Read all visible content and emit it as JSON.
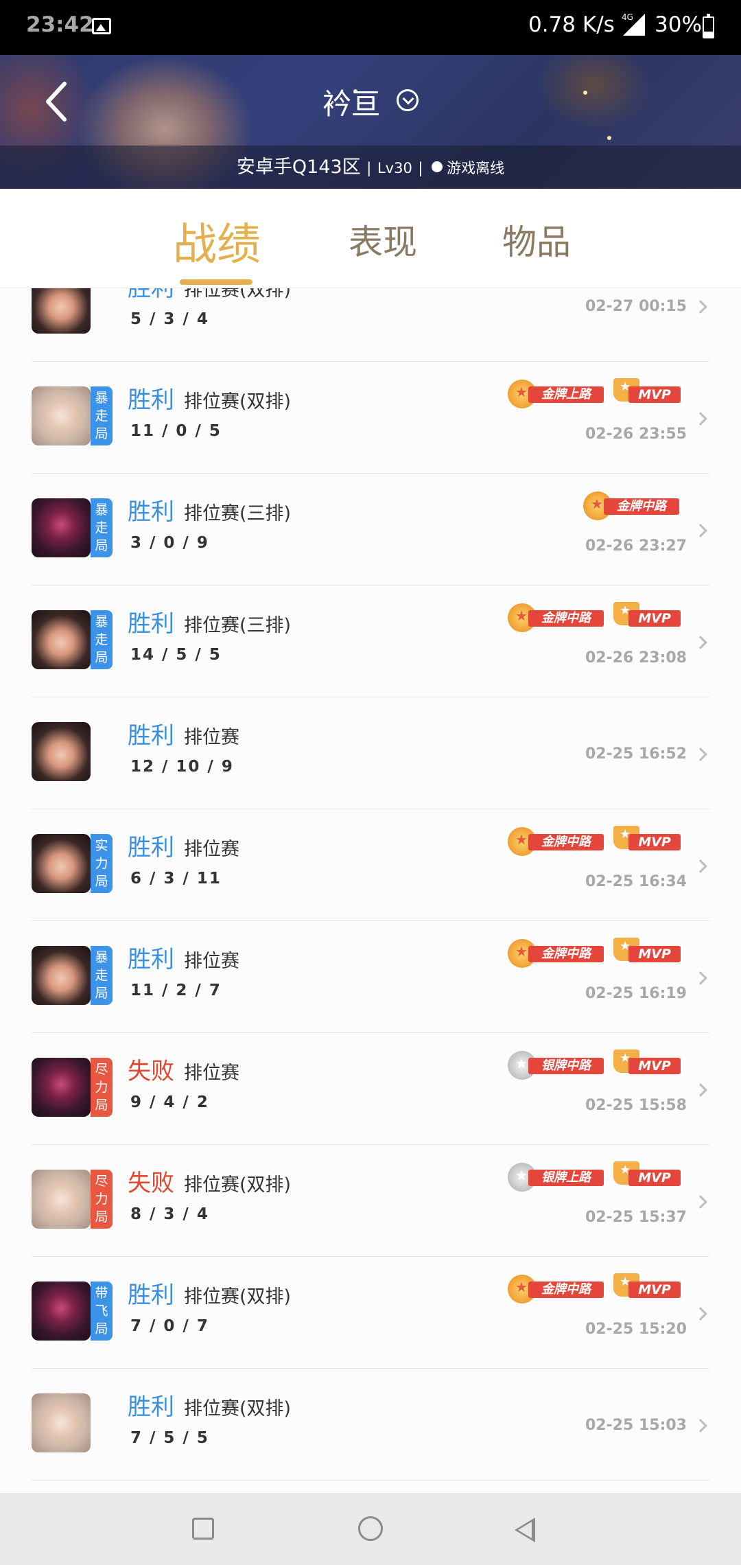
{
  "status_bar": {
    "time": "23:42",
    "network_speed": "0.78 K/s",
    "network_type": "4G",
    "battery": "30%"
  },
  "header": {
    "nickname": "衿亘",
    "server": "安卓手Q143区",
    "level": "Lv30",
    "separator": "|",
    "status": "游戏离线"
  },
  "tabs": [
    {
      "label": "战绩",
      "active": true
    },
    {
      "label": "表现",
      "active": false
    },
    {
      "label": "物品",
      "active": false
    }
  ],
  "matches": [
    {
      "hero": "h1",
      "tag": "",
      "result": "胜利",
      "outcome": "win",
      "mode": "排位赛(双排)",
      "kda": "5 / 3 / 4",
      "time": "02-27 00:15",
      "badge": "",
      "badge_type": "",
      "mvp": ""
    },
    {
      "hero": "h2",
      "tag": "暴走局",
      "tag_color": "blue",
      "result": "胜利",
      "outcome": "win",
      "mode": "排位赛(双排)",
      "kda": "11 / 0 / 5",
      "time": "02-26 23:55",
      "badge": "金牌上路",
      "badge_type": "gold",
      "mvp": "MVP"
    },
    {
      "hero": "h3",
      "tag": "暴走局",
      "tag_color": "blue",
      "result": "胜利",
      "outcome": "win",
      "mode": "排位赛(三排)",
      "kda": "3 / 0 / 9",
      "time": "02-26 23:27",
      "badge": "金牌中路",
      "badge_type": "gold",
      "mvp": ""
    },
    {
      "hero": "h1",
      "tag": "暴走局",
      "tag_color": "blue",
      "result": "胜利",
      "outcome": "win",
      "mode": "排位赛(三排)",
      "kda": "14 / 5 / 5",
      "time": "02-26 23:08",
      "badge": "金牌中路",
      "badge_type": "gold",
      "mvp": "MVP"
    },
    {
      "hero": "h1",
      "tag": "",
      "result": "胜利",
      "outcome": "win",
      "mode": "排位赛",
      "kda": "12 / 10 / 9",
      "time": "02-25 16:52",
      "badge": "",
      "badge_type": "",
      "mvp": ""
    },
    {
      "hero": "h1",
      "tag": "实力局",
      "tag_color": "blue",
      "result": "胜利",
      "outcome": "win",
      "mode": "排位赛",
      "kda": "6 / 3 / 11",
      "time": "02-25 16:34",
      "badge": "金牌中路",
      "badge_type": "gold",
      "mvp": "MVP"
    },
    {
      "hero": "h1",
      "tag": "暴走局",
      "tag_color": "blue",
      "result": "胜利",
      "outcome": "win",
      "mode": "排位赛",
      "kda": "11 / 2 / 7",
      "time": "02-25 16:19",
      "badge": "金牌中路",
      "badge_type": "gold",
      "mvp": "MVP"
    },
    {
      "hero": "h3",
      "tag": "尽力局",
      "tag_color": "red",
      "result": "失败",
      "outcome": "loss",
      "mode": "排位赛",
      "kda": "9 / 4 / 2",
      "time": "02-25 15:58",
      "badge": "银牌中路",
      "badge_type": "silver",
      "mvp": "MVP"
    },
    {
      "hero": "h2",
      "tag": "尽力局",
      "tag_color": "red",
      "result": "失败",
      "outcome": "loss",
      "mode": "排位赛(双排)",
      "kda": "8 / 3 / 4",
      "time": "02-25 15:37",
      "badge": "银牌上路",
      "badge_type": "silver",
      "mvp": "MVP"
    },
    {
      "hero": "h3",
      "tag": "带飞局",
      "tag_color": "blue",
      "result": "胜利",
      "outcome": "win",
      "mode": "排位赛(双排)",
      "kda": "7 / 0 / 7",
      "time": "02-25 15:20",
      "badge": "金牌中路",
      "badge_type": "gold",
      "mvp": "MVP"
    },
    {
      "hero": "h2",
      "tag": "",
      "result": "胜利",
      "outcome": "win",
      "mode": "排位赛(双排)",
      "kda": "7 / 5 / 5",
      "time": "02-25 15:03",
      "badge": "",
      "badge_type": "",
      "mvp": ""
    }
  ],
  "colors": {
    "accent": "#e4b04c",
    "win": "#3a8fde",
    "loss": "#e3462f",
    "tag_blue": "#3d93e8",
    "tag_red": "#e8573f",
    "ribbon_red": "#e5463b"
  },
  "icons": {
    "back": "back-arrow-icon",
    "dropdown": "chevron-circle-icon",
    "row_chevron": "chevron-right-icon",
    "nav_recent": "square-icon",
    "nav_home": "circle-icon",
    "nav_back": "triangle-back-icon"
  }
}
